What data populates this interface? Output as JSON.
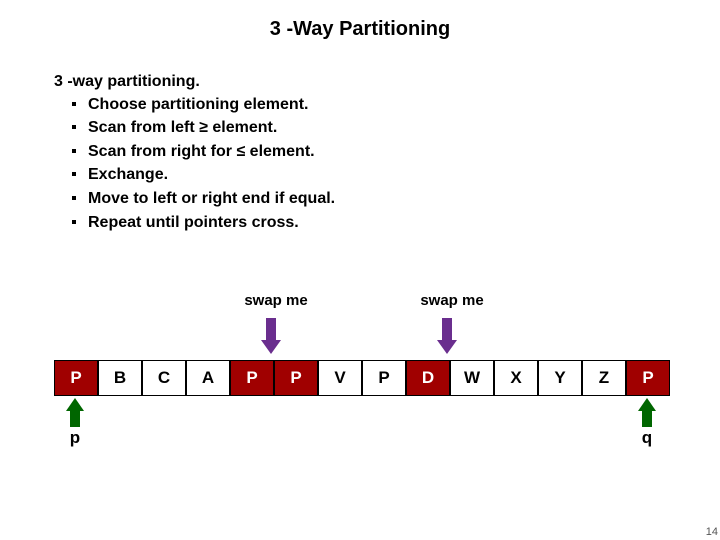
{
  "title": "3 -Way Partitioning",
  "subhead": "3 -way partitioning.",
  "bullets": [
    "Choose partitioning element.",
    "Scan from left ≥ element.",
    "Scan from right for ≤  element.",
    "Exchange.",
    "Move to left or right end if equal.",
    "Repeat until pointers cross."
  ],
  "swap_label_1": "swap me",
  "swap_label_2": "swap me",
  "cells": [
    {
      "v": "P",
      "red": true
    },
    {
      "v": "B",
      "red": false
    },
    {
      "v": "C",
      "red": false
    },
    {
      "v": "A",
      "red": false
    },
    {
      "v": "P",
      "red": true
    },
    {
      "v": "P",
      "red": true
    },
    {
      "v": "V",
      "red": false
    },
    {
      "v": "P",
      "red": false
    },
    {
      "v": "D",
      "red": true
    },
    {
      "v": "W",
      "red": false
    },
    {
      "v": "X",
      "red": false
    },
    {
      "v": "Y",
      "red": false
    },
    {
      "v": "Z",
      "red": false
    },
    {
      "v": "P",
      "red": true
    }
  ],
  "pointer_left": "p",
  "pointer_right": "q",
  "page_number": "14"
}
